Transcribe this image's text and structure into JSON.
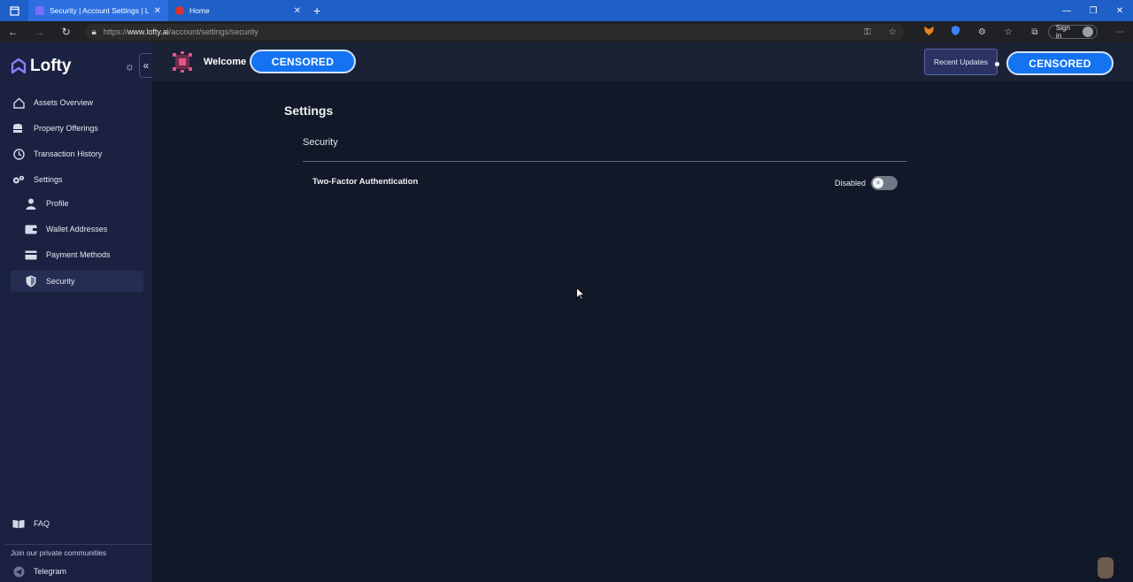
{
  "browser": {
    "tabs": [
      {
        "title": "Security | Account Settings | Lofty",
        "active": true,
        "favicon_color": "#7b6ef6"
      },
      {
        "title": "Home",
        "active": false,
        "favicon_color": "#d9342b"
      }
    ],
    "url_prefix": "https://",
    "url_host": "www.lofty.ai",
    "url_path": "/account/settings/security",
    "sign_in": "Sign in"
  },
  "sidebar": {
    "logo": "Lofty",
    "items": [
      {
        "label": "Assets Overview",
        "icon": "home-icon"
      },
      {
        "label": "Property Offerings",
        "icon": "coins-stack-icon"
      },
      {
        "label": "Transaction History",
        "icon": "clock-icon"
      },
      {
        "label": "Settings",
        "icon": "gears-icon"
      },
      {
        "label": "Profile",
        "icon": "person-icon"
      },
      {
        "label": "Wallet Addresses",
        "icon": "wallet-icon"
      },
      {
        "label": "Payment Methods",
        "icon": "credit-card-icon"
      },
      {
        "label": "Security",
        "icon": "shield-icon",
        "active": true
      }
    ],
    "faq": "FAQ",
    "community_heading": "Join our private communities",
    "telegram": "Telegram"
  },
  "header": {
    "welcome": "Welcome",
    "username_censored": "CENSORED",
    "recent_updates": "Recent Updates",
    "account_censored": "CENSORED"
  },
  "main": {
    "title": "Settings",
    "section": "Security",
    "two_factor_label": "Two-Factor Authentication",
    "two_factor_status": "Disabled",
    "two_factor_enabled": false
  },
  "colors": {
    "sidebar_bg": "#1b2141",
    "main_bg": "#111827",
    "accent_blue": "#1473f0",
    "browser_blue": "#1f5fc8"
  }
}
